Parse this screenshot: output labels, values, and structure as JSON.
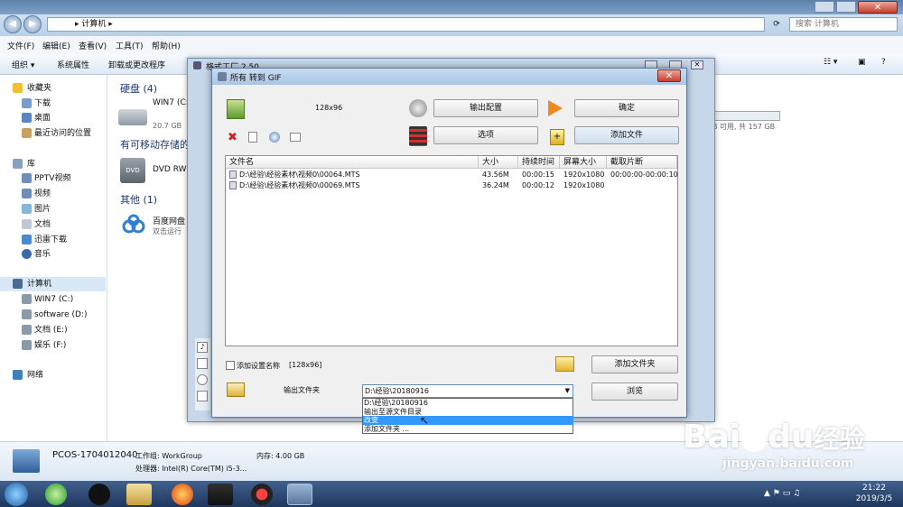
{
  "explorer": {
    "address": "▸ 计算机 ▸",
    "search_placeholder": "搜索 计算机",
    "menu": [
      "文件(F)",
      "编辑(E)",
      "查看(V)",
      "工具(T)",
      "帮助(H)"
    ],
    "commands": [
      "组织 ▾",
      "系统属性",
      "卸载或更改程序"
    ],
    "sidebar": {
      "favorites_title": "收藏夹",
      "favorites": [
        "下载",
        "桌面",
        "最近访问的位置"
      ],
      "libraries_title": "库",
      "libraries": [
        "PPTV视频",
        "视频",
        "图片",
        "文档",
        "迅雷下载",
        "音乐"
      ],
      "computer_title": "计算机",
      "drives": [
        "WIN7 (C:)",
        "software (D:)",
        "文档 (E:)",
        "娱乐 (F:)"
      ],
      "network": "网络"
    },
    "groups": {
      "hard_disks": "硬盘 (4)",
      "removable": "有可移动存储的",
      "other": "其他 (1)"
    },
    "items": {
      "drive_c_name": "WIN7 (C:",
      "drive_c_size": "20.7 GB",
      "dvd_name": "DVD RW",
      "baidu_name": "百度网盘",
      "baidu_sub": "双击运行",
      "right_drive_size": "B 可用, 共 157 GB"
    },
    "status": {
      "pc_name": "PCOS-1704012040",
      "workgroup": "工作组: WorkGroup",
      "memory": "内存: 4.00 GB",
      "cpu": "处理器: Intel(R) Core(TM) i5-3..."
    }
  },
  "back_window_title": "格式工厂 2.50",
  "dialog": {
    "title": "所有 转到 GIF",
    "preset_size": "128x96",
    "output_config_label": "输出配置",
    "ok_label": "确定",
    "options_label": "选项",
    "add_file_label": "添加文件",
    "columns": [
      "文件名",
      "大小",
      "持续时间",
      "屏幕大小",
      "截取片断"
    ],
    "files": [
      {
        "name": "D:\\经验\\经验素材\\视频0\\00064.MTS",
        "size": "43.56M",
        "duration": "00:00:15",
        "screen": "1920x1080",
        "clip": "00:00:00-00:00:10"
      },
      {
        "name": "D:\\经验\\经验素材\\视频0\\00069.MTS",
        "size": "36.24M",
        "duration": "00:00:12",
        "screen": "1920x1080",
        "clip": ""
      }
    ],
    "add_setting_name_label": "添加设置名称",
    "add_setting_name_value": "[128x96]",
    "add_folder_label": "添加文件夹",
    "output_folder_label": "输出文件夹",
    "output_folder_value": "D:\\经验\\20180916",
    "browse_label": "浏览",
    "dropdown_options": [
      "D:\\经验\\20180916",
      "输出至源文件目录",
      "改变",
      "添加文件夹 ..."
    ],
    "dropdown_selected_index": 2
  },
  "taskbar": {
    "time": "21:22",
    "date": "2019/3/5"
  },
  "watermark": {
    "brand": "Bai",
    "brand2": "du",
    "cn": "经验",
    "url": "jingyan.baidu.com"
  },
  "colors": {
    "selection": "#3399ff",
    "accent": "#1f3b70",
    "close_red": "#c6402b"
  }
}
